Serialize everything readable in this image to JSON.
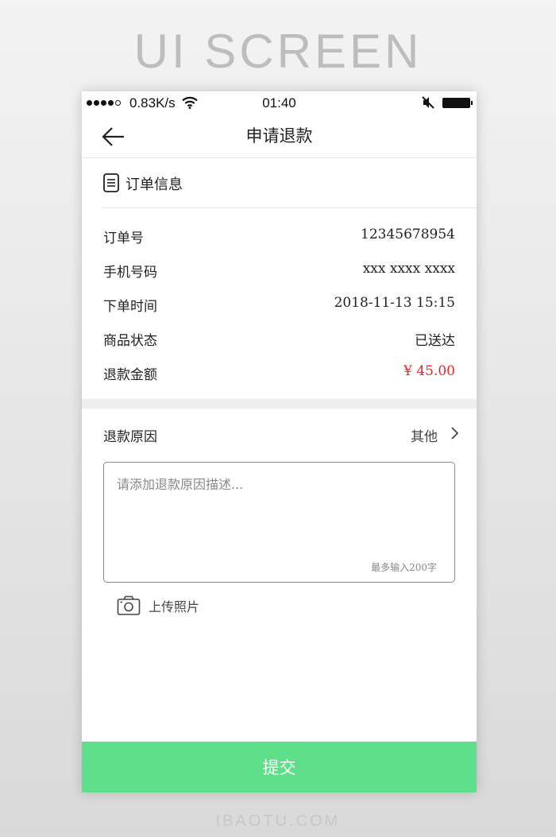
{
  "headline": "UI SCREEN",
  "footer_mark": "IBAOTU.COM",
  "status_bar": {
    "network_speed": "0.83K/s",
    "time": "01:40",
    "signal_icon": "signal-dots-icon",
    "wifi_icon": "wifi-icon",
    "mute_icon": "mute-icon",
    "battery_icon": "battery-icon"
  },
  "nav": {
    "title": "申请退款",
    "back_icon": "arrow-left-icon"
  },
  "order_section": {
    "title": "订单信息",
    "icon": "document-icon",
    "rows": [
      {
        "label": "订单号",
        "value": "12345678954"
      },
      {
        "label": "手机号码",
        "value": "xxx xxxx xxxx"
      },
      {
        "label": "下单时间",
        "value": "2018-11-13  15:15"
      },
      {
        "label": "商品状态",
        "value": "已送达"
      },
      {
        "label": "退款金额",
        "value": "¥  45.00"
      }
    ],
    "price_color": "#e8272c"
  },
  "reason": {
    "label": "退款原因",
    "selected": "其他",
    "chevron_icon": "chevron-right-icon"
  },
  "description": {
    "placeholder": "请添加退款原因描述...",
    "value": "",
    "limit_hint": "最多输入200字"
  },
  "upload": {
    "label": "上传照片",
    "icon": "camera-icon"
  },
  "submit": {
    "label": "提交",
    "color": "#5fdf89"
  }
}
